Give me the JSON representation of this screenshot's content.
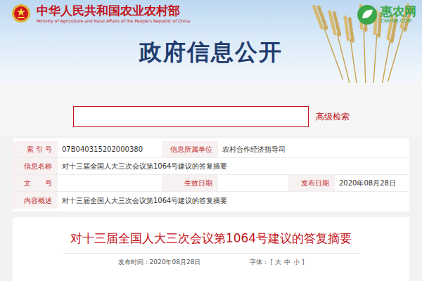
{
  "header": {
    "ministry_cn": "中华人民共和国农业农村部",
    "ministry_en": "Ministry of Agriculture and Rural Affairs of the People's Republic of China",
    "title": "政府信息公开"
  },
  "watermark": {
    "name": "惠农网",
    "domain": "CNHNB.COM"
  },
  "search": {
    "placeholder": "",
    "advanced": "高级检索"
  },
  "info_table": {
    "rows": [
      [
        {
          "kind": "label",
          "text": "索 引 号"
        },
        {
          "kind": "value",
          "text": "07B040315202000380"
        },
        {
          "kind": "label",
          "text": "信息所属单位"
        },
        {
          "kind": "value",
          "text": "农村合作经济指导司"
        }
      ],
      [
        {
          "kind": "label",
          "text": "信息名称"
        },
        {
          "kind": "value",
          "text": "对十三届全国人大三次会议第1064号建议的答复摘要"
        }
      ],
      [
        {
          "kind": "label",
          "text": "文　　号"
        },
        {
          "kind": "value",
          "text": ""
        },
        {
          "kind": "label",
          "text": "生效日期"
        },
        {
          "kind": "value",
          "text": ""
        },
        {
          "kind": "label",
          "text": "发布日期"
        },
        {
          "kind": "value",
          "text": "2020年08月28日"
        }
      ],
      [
        {
          "kind": "label",
          "text": "内容概述"
        },
        {
          "kind": "value",
          "text": "对十三届全国人大三次会议第1064号建议的答复摘要"
        }
      ]
    ]
  },
  "article": {
    "title": "对十三届全国人大三次会议第1064号建议的答复摘要",
    "publish_label": "发布时间：",
    "publish_date": "2020年08月28日",
    "font_label": "字体：",
    "font_open": "[",
    "font_sizes": [
      "大",
      "中",
      "小"
    ],
    "font_close": "]"
  }
}
